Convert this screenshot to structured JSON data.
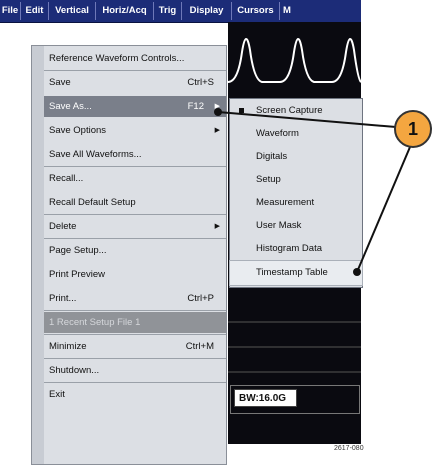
{
  "menubar": {
    "items": [
      "File",
      "Edit",
      "Vertical",
      "Horiz/Acq",
      "Trig",
      "Display",
      "Cursors",
      "M"
    ]
  },
  "file_menu": {
    "items": [
      {
        "label": "Reference Waveform Controls...",
        "shortcut": "",
        "submenu": false
      },
      {
        "label": "Save",
        "shortcut": "Ctrl+S",
        "submenu": false
      },
      {
        "label": "Save As...",
        "shortcut": "F12",
        "submenu": true,
        "highlighted": true
      },
      {
        "label": "Save Options",
        "shortcut": "",
        "submenu": true
      },
      {
        "label": "Save All Waveforms...",
        "shortcut": "",
        "submenu": false
      },
      {
        "label": "Recall...",
        "shortcut": "",
        "submenu": false
      },
      {
        "label": "Recall Default Setup",
        "shortcut": "",
        "submenu": false
      },
      {
        "label": "Delete",
        "shortcut": "",
        "submenu": true
      },
      {
        "label": "Page Setup...",
        "shortcut": "",
        "submenu": false
      },
      {
        "label": "Print Preview",
        "shortcut": "",
        "submenu": false
      },
      {
        "label": "Print...",
        "shortcut": "Ctrl+P",
        "submenu": false
      },
      {
        "label": "1 Recent Setup File 1",
        "shortcut": "",
        "submenu": false,
        "disabled": true
      },
      {
        "label": "Minimize",
        "shortcut": "Ctrl+M",
        "submenu": false
      },
      {
        "label": "Shutdown...",
        "shortcut": "",
        "submenu": false
      },
      {
        "label": "Exit",
        "shortcut": "",
        "submenu": false
      }
    ]
  },
  "save_as_submenu": {
    "items": [
      {
        "label": "Screen Capture",
        "selected": true
      },
      {
        "label": "Waveform"
      },
      {
        "label": "Digitals"
      },
      {
        "label": "Setup"
      },
      {
        "label": "Measurement"
      },
      {
        "label": "User Mask"
      },
      {
        "label": "Histogram Data"
      },
      {
        "label": "Timestamp Table",
        "highlighted": true
      }
    ]
  },
  "readout": {
    "text": "BW:16.0G"
  },
  "callout": {
    "number": "1"
  },
  "figure_number": "2617-080",
  "colors": {
    "menubar": "#1c2c78",
    "callout": "#f4a640",
    "trace": "#ffffff"
  }
}
